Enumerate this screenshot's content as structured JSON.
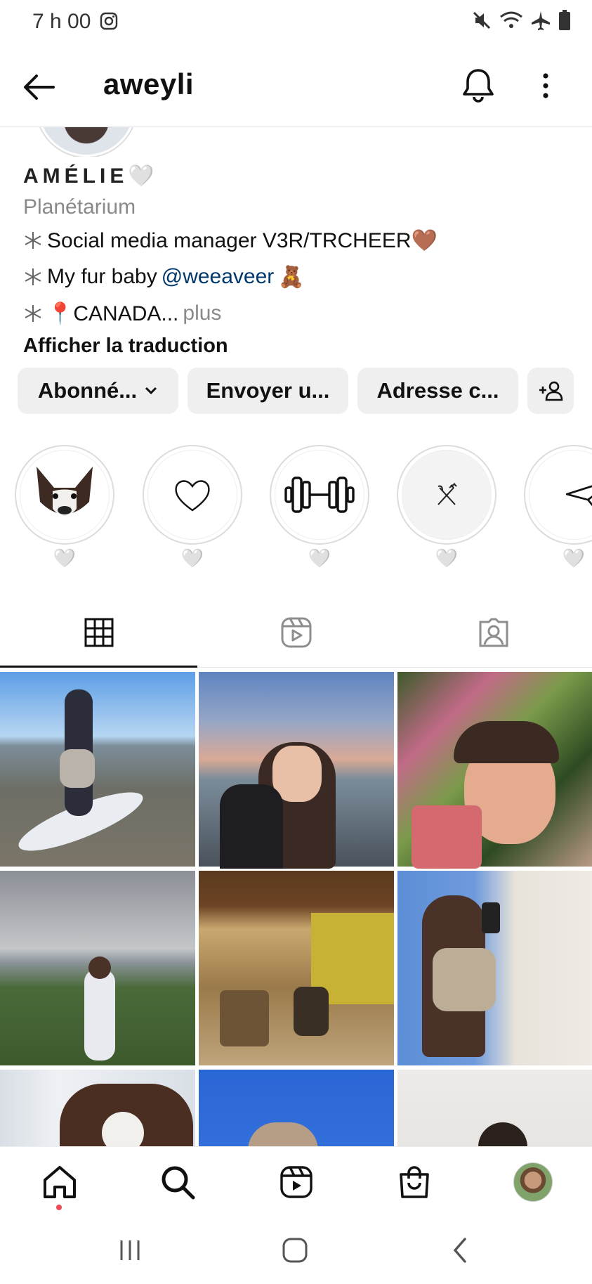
{
  "status_bar": {
    "time": "7 h 00",
    "icons": [
      "instagram-icon",
      "mute-icon",
      "wifi-icon",
      "airplane-icon",
      "battery-icon"
    ]
  },
  "header": {
    "username": "aweyli",
    "icons": [
      "back-arrow-icon",
      "bell-icon",
      "more-vertical-icon"
    ]
  },
  "bio": {
    "name": "AMÉLIE🤍",
    "category": "Planétarium",
    "lines": [
      {
        "text": "Social media manager V3R/TRCHEER🤎"
      },
      {
        "text": "My fur baby ",
        "mention": "@weeaveer",
        "suffix": " 🧸"
      },
      {
        "text": "📍CANADA...",
        "more": " plus"
      }
    ],
    "translate": "Afficher la traduction"
  },
  "actions": {
    "following": "Abonné...",
    "message": "Envoyer u...",
    "email": "Adresse c...",
    "add_user_icon": "add-user-icon"
  },
  "highlights": [
    {
      "label": "🤍",
      "icon": "corgi-photo"
    },
    {
      "label": "🤍",
      "icon": "heart-outline-icon"
    },
    {
      "label": "🤍",
      "icon": "dumbbell-icon"
    },
    {
      "label": "🤍",
      "icon": "fork-knife-icon"
    },
    {
      "label": "🤍",
      "icon": "paper-plane-icon"
    }
  ],
  "tabs": [
    "grid-icon",
    "reels-icon",
    "tagged-icon"
  ],
  "bottom_nav": [
    "home-icon",
    "search-icon",
    "reels-icon",
    "shop-icon",
    "profile-avatar"
  ],
  "colors": {
    "mention": "#00376b",
    "muted": "#8a8a8a",
    "button_bg": "#efefef",
    "notification_dot": "#ed4956"
  }
}
